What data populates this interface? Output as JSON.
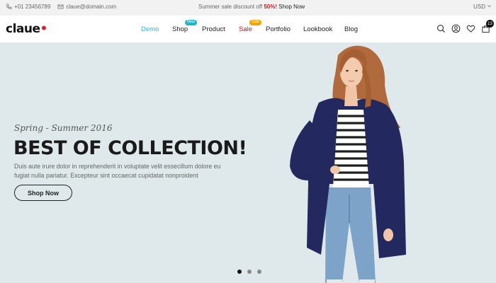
{
  "topbar": {
    "phone": "+01 23456789",
    "email": "claue@domain.com",
    "promo_text": "Summer sale discount off ",
    "promo_percent": "50%!",
    "promo_link": "Shop Now",
    "currency": "USD",
    "phone_icon": "phone-icon",
    "email_icon": "envelope-icon"
  },
  "header": {
    "logo": "claue",
    "nav": [
      {
        "label": "Demo",
        "active": true
      },
      {
        "label": "Shop",
        "badge": "New"
      },
      {
        "label": "Product"
      },
      {
        "label": "Sale",
        "badge": "Sale"
      },
      {
        "label": "Portfolio"
      },
      {
        "label": "Lookbook"
      },
      {
        "label": "Blog"
      }
    ],
    "cart_count": "13",
    "icons": [
      "search-icon",
      "user-icon",
      "heart-icon",
      "cart-icon"
    ]
  },
  "hero": {
    "season": "Spring - Summer 2016",
    "headline": "BEST OF COLLECTION!",
    "description": "Duis aute irure dolor in reprehenderit in voluptate velit essecillum dolore eu fugiat nulla pariatur. Excepteur sint occaecat cupidatat nonproident",
    "cta": "Shop Now",
    "slide_count": 3,
    "active_slide": 1
  },
  "colors": {
    "accent": "#25b7d3",
    "sale": "#dd1111",
    "hero_bg": "#dfe9eb",
    "badge_new": "#1fb6c9",
    "badge_sale": "#f2a500"
  }
}
